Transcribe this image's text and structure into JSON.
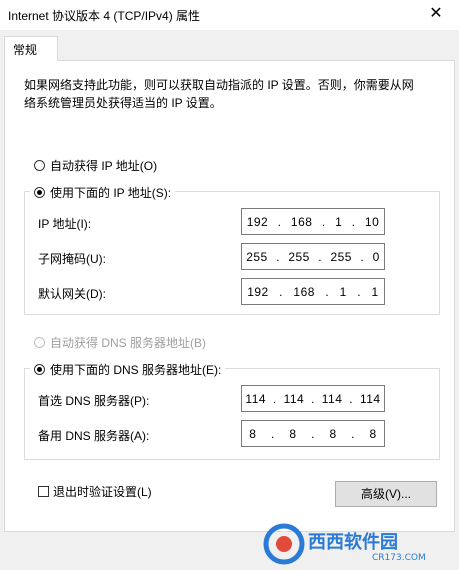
{
  "window": {
    "title": "Internet 协议版本 4 (TCP/IPv4) 属性",
    "close_glyph": "✕"
  },
  "tab": {
    "label": "常规"
  },
  "description": "如果网络支持此功能，则可以获取自动指派的 IP 设置。否则，你需要从网络系统管理员处获得适当的 IP 设置。",
  "ip_auto": {
    "label": "自动获得 IP 地址(O)",
    "selected": false
  },
  "ip_manual": {
    "label": "使用下面的 IP 地址(S):",
    "selected": true
  },
  "ip_fields": [
    {
      "label": "IP 地址(I):",
      "octets": [
        "192",
        "168",
        "1",
        "10"
      ]
    },
    {
      "label": "子网掩码(U):",
      "octets": [
        "255",
        "255",
        "255",
        "0"
      ]
    },
    {
      "label": "默认网关(D):",
      "octets": [
        "192",
        "168",
        "1",
        "1"
      ]
    }
  ],
  "dns_auto": {
    "label": "自动获得 DNS 服务器地址(B)",
    "selected": false,
    "disabled": true
  },
  "dns_manual": {
    "label": "使用下面的 DNS 服务器地址(E):",
    "selected": true
  },
  "dns_fields": [
    {
      "label": "首选 DNS 服务器(P):",
      "octets": [
        "114",
        "114",
        "114",
        "114"
      ]
    },
    {
      "label": "备用 DNS 服务器(A):",
      "octets": [
        "8",
        "8",
        "8",
        "8"
      ]
    }
  ],
  "validate": {
    "label": "退出时验证设置(L)",
    "checked": false
  },
  "advanced_button": "高级(V)...",
  "watermark": {
    "text": "西西软件园",
    "url": "CR173.COM"
  },
  "colors": {
    "dialog_bg": "#f0f0f0",
    "panel_bg": "#ffffff",
    "border": "#dcdcdc",
    "disabled_text": "#a0a0a0",
    "watermark": "#2a7ad6"
  }
}
